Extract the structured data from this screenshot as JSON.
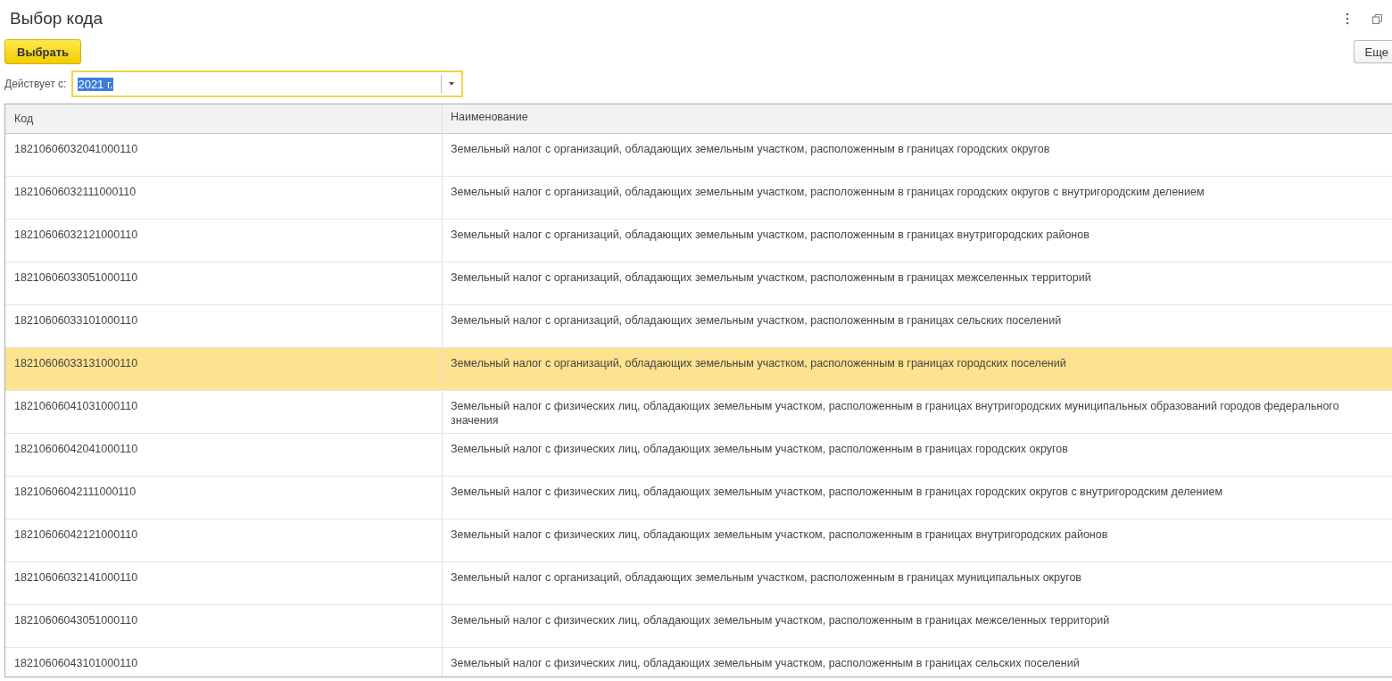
{
  "window": {
    "title": "Выбор кода"
  },
  "toolbar": {
    "select_button": "Выбрать",
    "more_button": "Еще"
  },
  "filter": {
    "label": "Действует с:",
    "value": "2021 г."
  },
  "table": {
    "columns": [
      "Код",
      "Наименование"
    ],
    "rows": [
      {
        "code": "18210606032041000110",
        "name": "Земельный налог с организаций, обладающих земельным участком, расположенным в границах городских округов",
        "selected": false
      },
      {
        "code": "18210606032111000110",
        "name": "Земельный налог с организаций, обладающих земельным участком, расположенным в границах городских округов с внутригородским делением",
        "selected": false
      },
      {
        "code": "18210606032121000110",
        "name": "Земельный налог с организаций, обладающих земельным участком, расположенным в границах внутригородских районов",
        "selected": false
      },
      {
        "code": "18210606033051000110",
        "name": "Земельный налог с организаций, обладающих земельным участком, расположенным в границах межселенных территорий",
        "selected": false
      },
      {
        "code": "18210606033101000110",
        "name": "Земельный налог с организаций, обладающих земельным участком, расположенным в границах сельских поселений",
        "selected": false
      },
      {
        "code": "18210606033131000110",
        "name": "Земельный налог с организаций, обладающих земельным участком, расположенным в границах городских поселений",
        "selected": true
      },
      {
        "code": "18210606041031000110",
        "name": "Земельный налог с физических лиц, обладающих земельным участком, расположенным в границах внутригородских муниципальных образований городов федерального значения",
        "selected": false
      },
      {
        "code": "18210606042041000110",
        "name": "Земельный налог с физических лиц, обладающих земельным участком, расположенным в границах городских округов",
        "selected": false
      },
      {
        "code": "18210606042111000110",
        "name": "Земельный налог с физических лиц, обладающих земельным участком, расположенным в границах городских округов с внутригородским делением",
        "selected": false
      },
      {
        "code": "18210606042121000110",
        "name": "Земельный налог с физических лиц, обладающих земельным участком, расположенным в границах внутригородских районов",
        "selected": false
      },
      {
        "code": "18210606032141000110",
        "name": "Земельный налог с организаций, обладающих земельным участком, расположенным в границах муниципальных округов",
        "selected": false
      },
      {
        "code": "18210606043051000110",
        "name": "Земельный налог с физических лиц, обладающих земельным участком, расположенным в границах межселенных территорий",
        "selected": false
      },
      {
        "code": "18210606043101000110",
        "name": "Земельный налог с физических лиц, обладающих земельным участком, расположенным в границах сельских поселений",
        "selected": false
      }
    ]
  }
}
